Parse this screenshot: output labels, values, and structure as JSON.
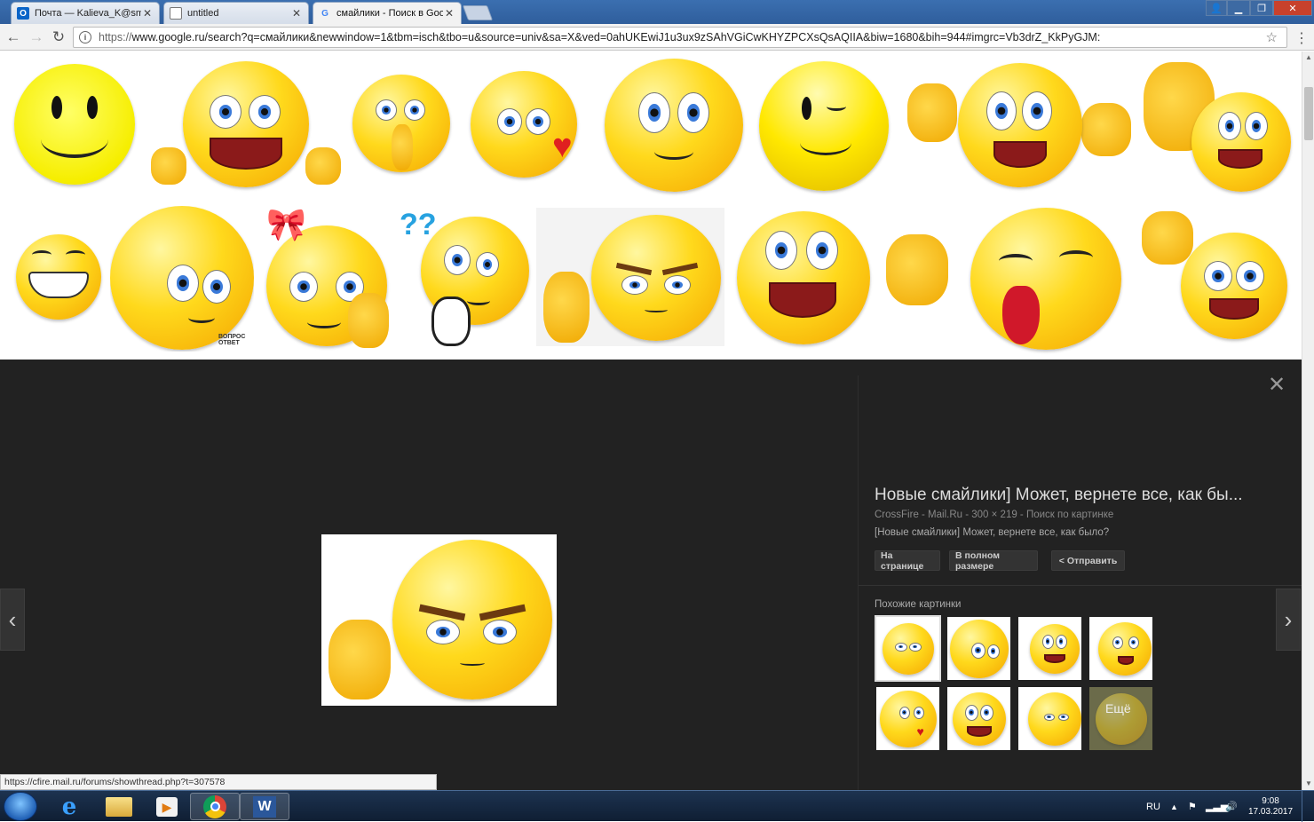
{
  "tabs": [
    {
      "title": "Почта — Kalieva_K@sm",
      "favicon": "outlook-icon",
      "active": false
    },
    {
      "title": "untitled",
      "favicon": "document-icon",
      "active": false
    },
    {
      "title": "смайлики - Поиск в Goo",
      "favicon": "google-icon",
      "active": true
    }
  ],
  "address": {
    "scheme": "https://",
    "url": "www.google.ru/search?q=смайлики&newwindow=1&tbm=isch&tbo=u&source=univ&sa=X&ved=0ahUKEwiJ1u3ux9zSAhVGiCwKHYZPCXsQsAQIIA&biw=1680&bih=944#imgrc=Vb3drZ_KkPyGJM:"
  },
  "preview": {
    "title": "Новые смайлики] Может, вернете все, как бы...",
    "meta": "CrossFire - Mail.Ru - 300 × 219 - Поиск по картинке",
    "description": "[Новые смайлики] Может, вернете все, как было?",
    "buttons": {
      "page": "На странице",
      "full": "В полном размере",
      "share": "Отправить"
    },
    "similar_label": "Похожие картинки",
    "more_label": "Ещё"
  },
  "watermark": "ВОПРОС ОТВЕТ",
  "status_url": "https://cfire.mail.ru/forums/showthread.php?t=307578",
  "taskbar": {
    "lang": "RU",
    "time": "9:08",
    "date": "17.03.2017"
  },
  "colors": {
    "preview_bg": "#222222",
    "smiley_yellow": "#ffd91c",
    "tabstrip": "#3b6fb0"
  }
}
